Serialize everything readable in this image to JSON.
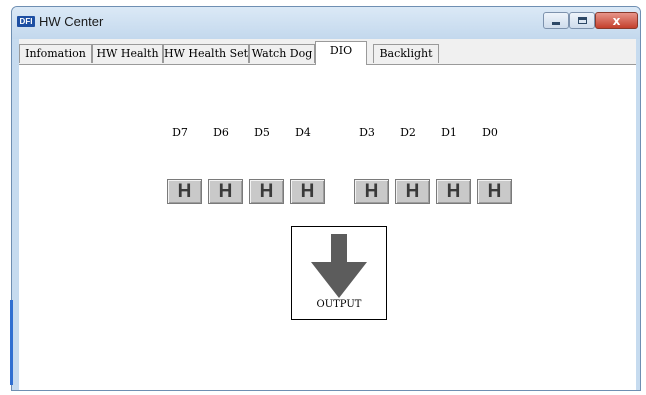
{
  "window": {
    "title": "HW Center",
    "app_icon_text": "DFI",
    "close_glyph": "x"
  },
  "tabs": [
    {
      "label": "Infomation",
      "active": false
    },
    {
      "label": "HW Health",
      "active": false
    },
    {
      "label": "HW Health Set",
      "active": false
    },
    {
      "label": "Watch Dog",
      "active": false
    },
    {
      "label": "DIO",
      "active": true
    },
    {
      "label": "Backlight",
      "active": false
    }
  ],
  "dio": {
    "bits": [
      {
        "label": "D7",
        "state": "H"
      },
      {
        "label": "D6",
        "state": "H"
      },
      {
        "label": "D5",
        "state": "H"
      },
      {
        "label": "D4",
        "state": "H"
      },
      {
        "label": "D3",
        "state": "H"
      },
      {
        "label": "D2",
        "state": "H"
      },
      {
        "label": "D1",
        "state": "H"
      },
      {
        "label": "D0",
        "state": "H"
      }
    ],
    "direction_label": "OUTPUT",
    "direction_icon": "arrow-down-icon"
  },
  "colors": {
    "titlebar": "#c6dbef",
    "close_button": "#c4402d",
    "bit_button": "#c9c9c9",
    "arrow": "#5c5c5c"
  }
}
